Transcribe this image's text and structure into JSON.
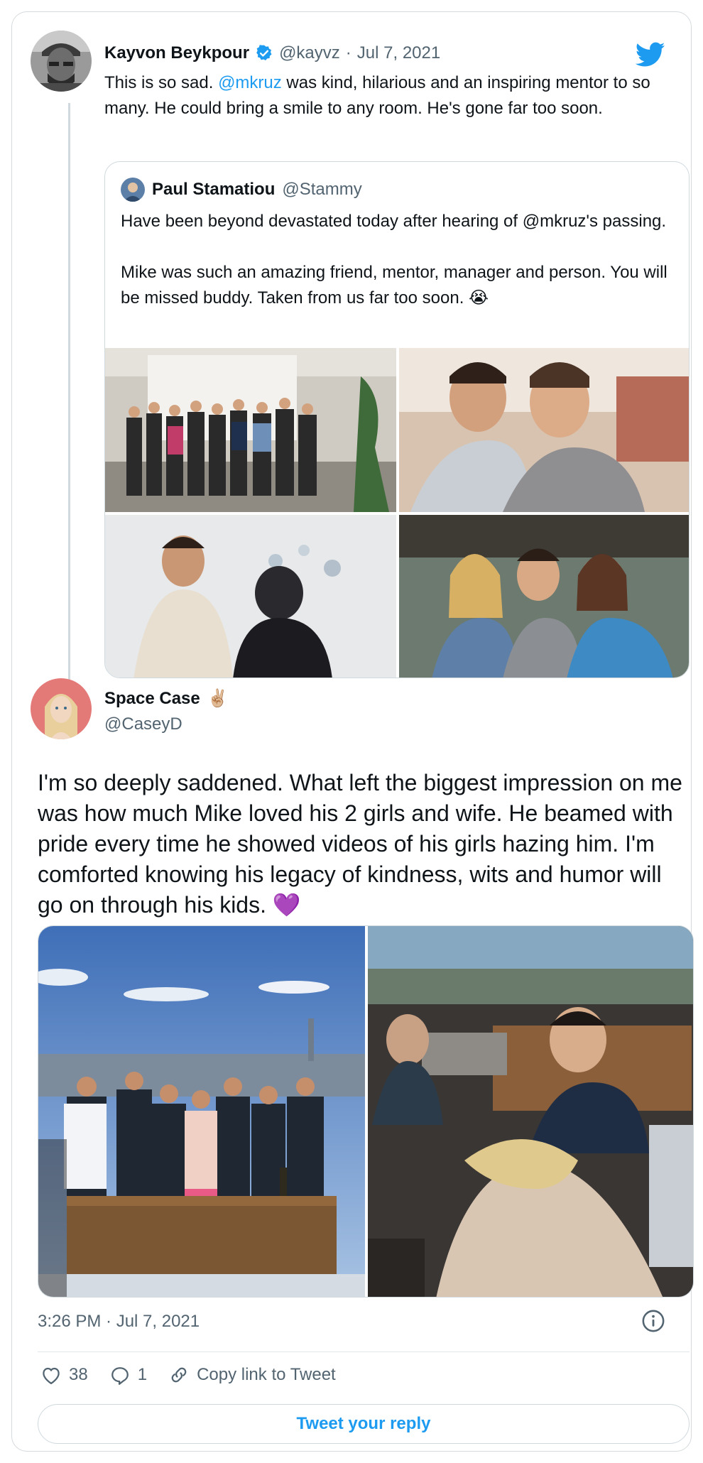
{
  "tweet": {
    "author_name": "Kayvon Beykpour",
    "author_handle": "@kayvz",
    "separator": "·",
    "date": "Jul 7, 2021",
    "text_before": "This is so sad. ",
    "mention": "@mkruz",
    "text_after": " was kind, hilarious and an inspiring mentor to so many. He could bring a smile to any room. He's gone far too soon.",
    "quote": {
      "author_name": "Paul Stamatiou",
      "author_handle": "@Stammy",
      "paragraph1": "Have been beyond devastated today after hearing of @mkruz's passing.",
      "paragraph2": "Mike was such an amazing friend, mentor, manager and person. You will be missed buddy. Taken from us far too soon. 😭"
    }
  },
  "reply": {
    "author_name": "Space Case",
    "author_emoji": "✌🏼",
    "author_handle": "@CaseyD",
    "text": "I'm so deeply saddened. What left the biggest impression on me was how much Mike loved his 2 girls and wife. He beamed with pride every time he showed videos of his girls hazing him. I'm comforted knowing his legacy of kindness, wits and humor will go on through his kids. 💜",
    "timestamp": "3:26 PM · Jul 7, 2021"
  },
  "actions": {
    "likes": "38",
    "replies": "1",
    "copy_link": "Copy link to Tweet",
    "reply_button": "Tweet your reply"
  },
  "colors": {
    "brand_blue": "#1d9bf0",
    "muted_text": "#536471",
    "border": "#cfd9de"
  },
  "icons": [
    "twitter-bird-icon",
    "verified-badge-icon",
    "heart-icon",
    "reply-icon",
    "link-icon",
    "info-icon"
  ]
}
